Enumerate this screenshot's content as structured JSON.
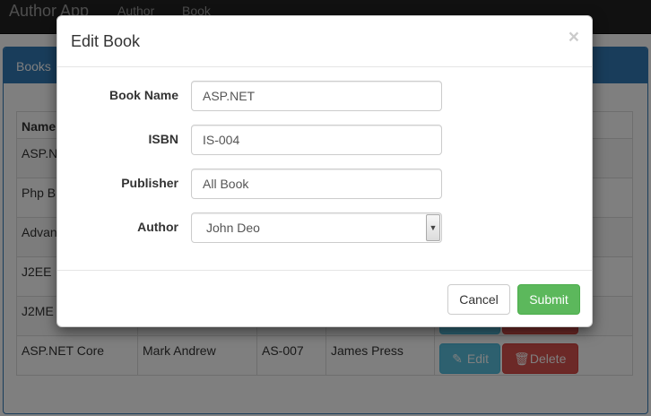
{
  "navbar": {
    "brand": "Author App",
    "links": [
      "Author",
      "Book"
    ]
  },
  "panel": {
    "heading": "Books"
  },
  "table": {
    "headers": [
      "Name",
      "",
      "",
      "",
      ""
    ],
    "rows": [
      {
        "name": "ASP.N",
        "author": "",
        "isbn": "",
        "publisher": ""
      },
      {
        "name": "Php B",
        "author": "",
        "isbn": "",
        "publisher": ""
      },
      {
        "name": "Advan",
        "author": "",
        "isbn": "",
        "publisher": ""
      },
      {
        "name": "J2EE",
        "author": "",
        "isbn": "",
        "publisher": ""
      },
      {
        "name": "J2ME",
        "author": "",
        "isbn": "",
        "publisher": ""
      },
      {
        "name": "ASP.NET Core",
        "author": "Mark Andrew",
        "isbn": "AS-007",
        "publisher": "James Press"
      }
    ],
    "edit_label": "Edit",
    "delete_label": "Delete"
  },
  "modal": {
    "title": "Edit Book",
    "close_glyph": "×",
    "fields": {
      "book_name": {
        "label": "Book Name",
        "value": "ASP.NET"
      },
      "isbn": {
        "label": "ISBN",
        "value": "IS-004"
      },
      "publisher": {
        "label": "Publisher",
        "value": "All Book"
      },
      "author": {
        "label": "Author",
        "selected": "John Deo"
      }
    },
    "cancel_label": "Cancel",
    "submit_label": "Submit"
  },
  "colors": {
    "primary": "#337ab7",
    "info": "#5bc0de",
    "danger": "#d9534f",
    "success": "#5cb85c",
    "navbar": "#222222"
  },
  "icons": {
    "edit": "pencil-icon",
    "delete": "trash-icon",
    "select": "chevron-down-icon"
  }
}
